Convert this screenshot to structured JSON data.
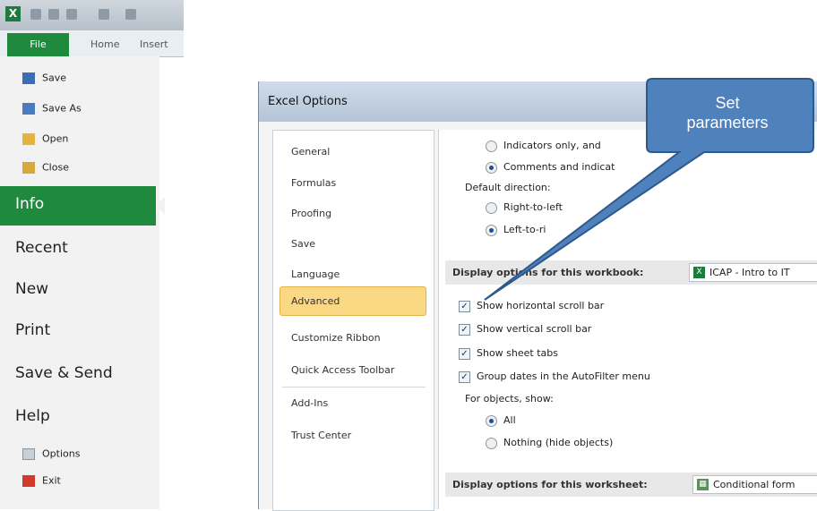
{
  "backstage": {
    "ribbon_tabs": {
      "file": "File",
      "home": "Home",
      "insert": "Insert"
    },
    "small_items": [
      {
        "label": "Save",
        "icon": "save-icon"
      },
      {
        "label": "Save As",
        "icon": "save-as-icon"
      },
      {
        "label": "Open",
        "icon": "open-folder-icon"
      },
      {
        "label": "Close",
        "icon": "close-folder-icon"
      }
    ],
    "selected": "Info",
    "big_items": [
      "Recent",
      "New",
      "Print",
      "Save & Send",
      "Help"
    ],
    "bottom_items": [
      {
        "label": "Options",
        "icon": "options-icon"
      },
      {
        "label": "Exit",
        "icon": "exit-icon"
      }
    ]
  },
  "dialog": {
    "title": "Excel Options",
    "nav_items": [
      "General",
      "Formulas",
      "Proofing",
      "Save",
      "Language",
      "Advanced",
      "Customize Ribbon",
      "Quick Access Toolbar",
      "Add-Ins",
      "Trust Center"
    ],
    "selected_nav": "Advanced",
    "content": {
      "radio_indicators_only": "Indicators only, and",
      "radio_comments": "Comments and indicat",
      "default_direction_label": "Default direction:",
      "radio_rtl": "Right-to-left",
      "radio_ltr": "Left-to-ri",
      "workbook_section": "Display options for this workbook:",
      "workbook_select": "ICAP - Intro to IT",
      "checkboxes": [
        {
          "label": "Show horizontal scroll bar",
          "checked": true
        },
        {
          "label": "Show vertical scroll bar",
          "checked": true
        },
        {
          "label": "Show sheet tabs",
          "checked": true
        },
        {
          "label": "Group dates in the AutoFilter menu",
          "checked": true
        }
      ],
      "objects_label": "For objects, show:",
      "radio_all": "All",
      "radio_nothing": "Nothing (hide objects)",
      "worksheet_section": "Display options for this worksheet:",
      "worksheet_select": "Conditional form"
    }
  },
  "callout": {
    "text_line1": "Set",
    "text_line2": "parameters",
    "color": "#4f81bd"
  },
  "colors": {
    "file_green": "#1f8a3d",
    "advanced_highlight": "#fbd884"
  }
}
